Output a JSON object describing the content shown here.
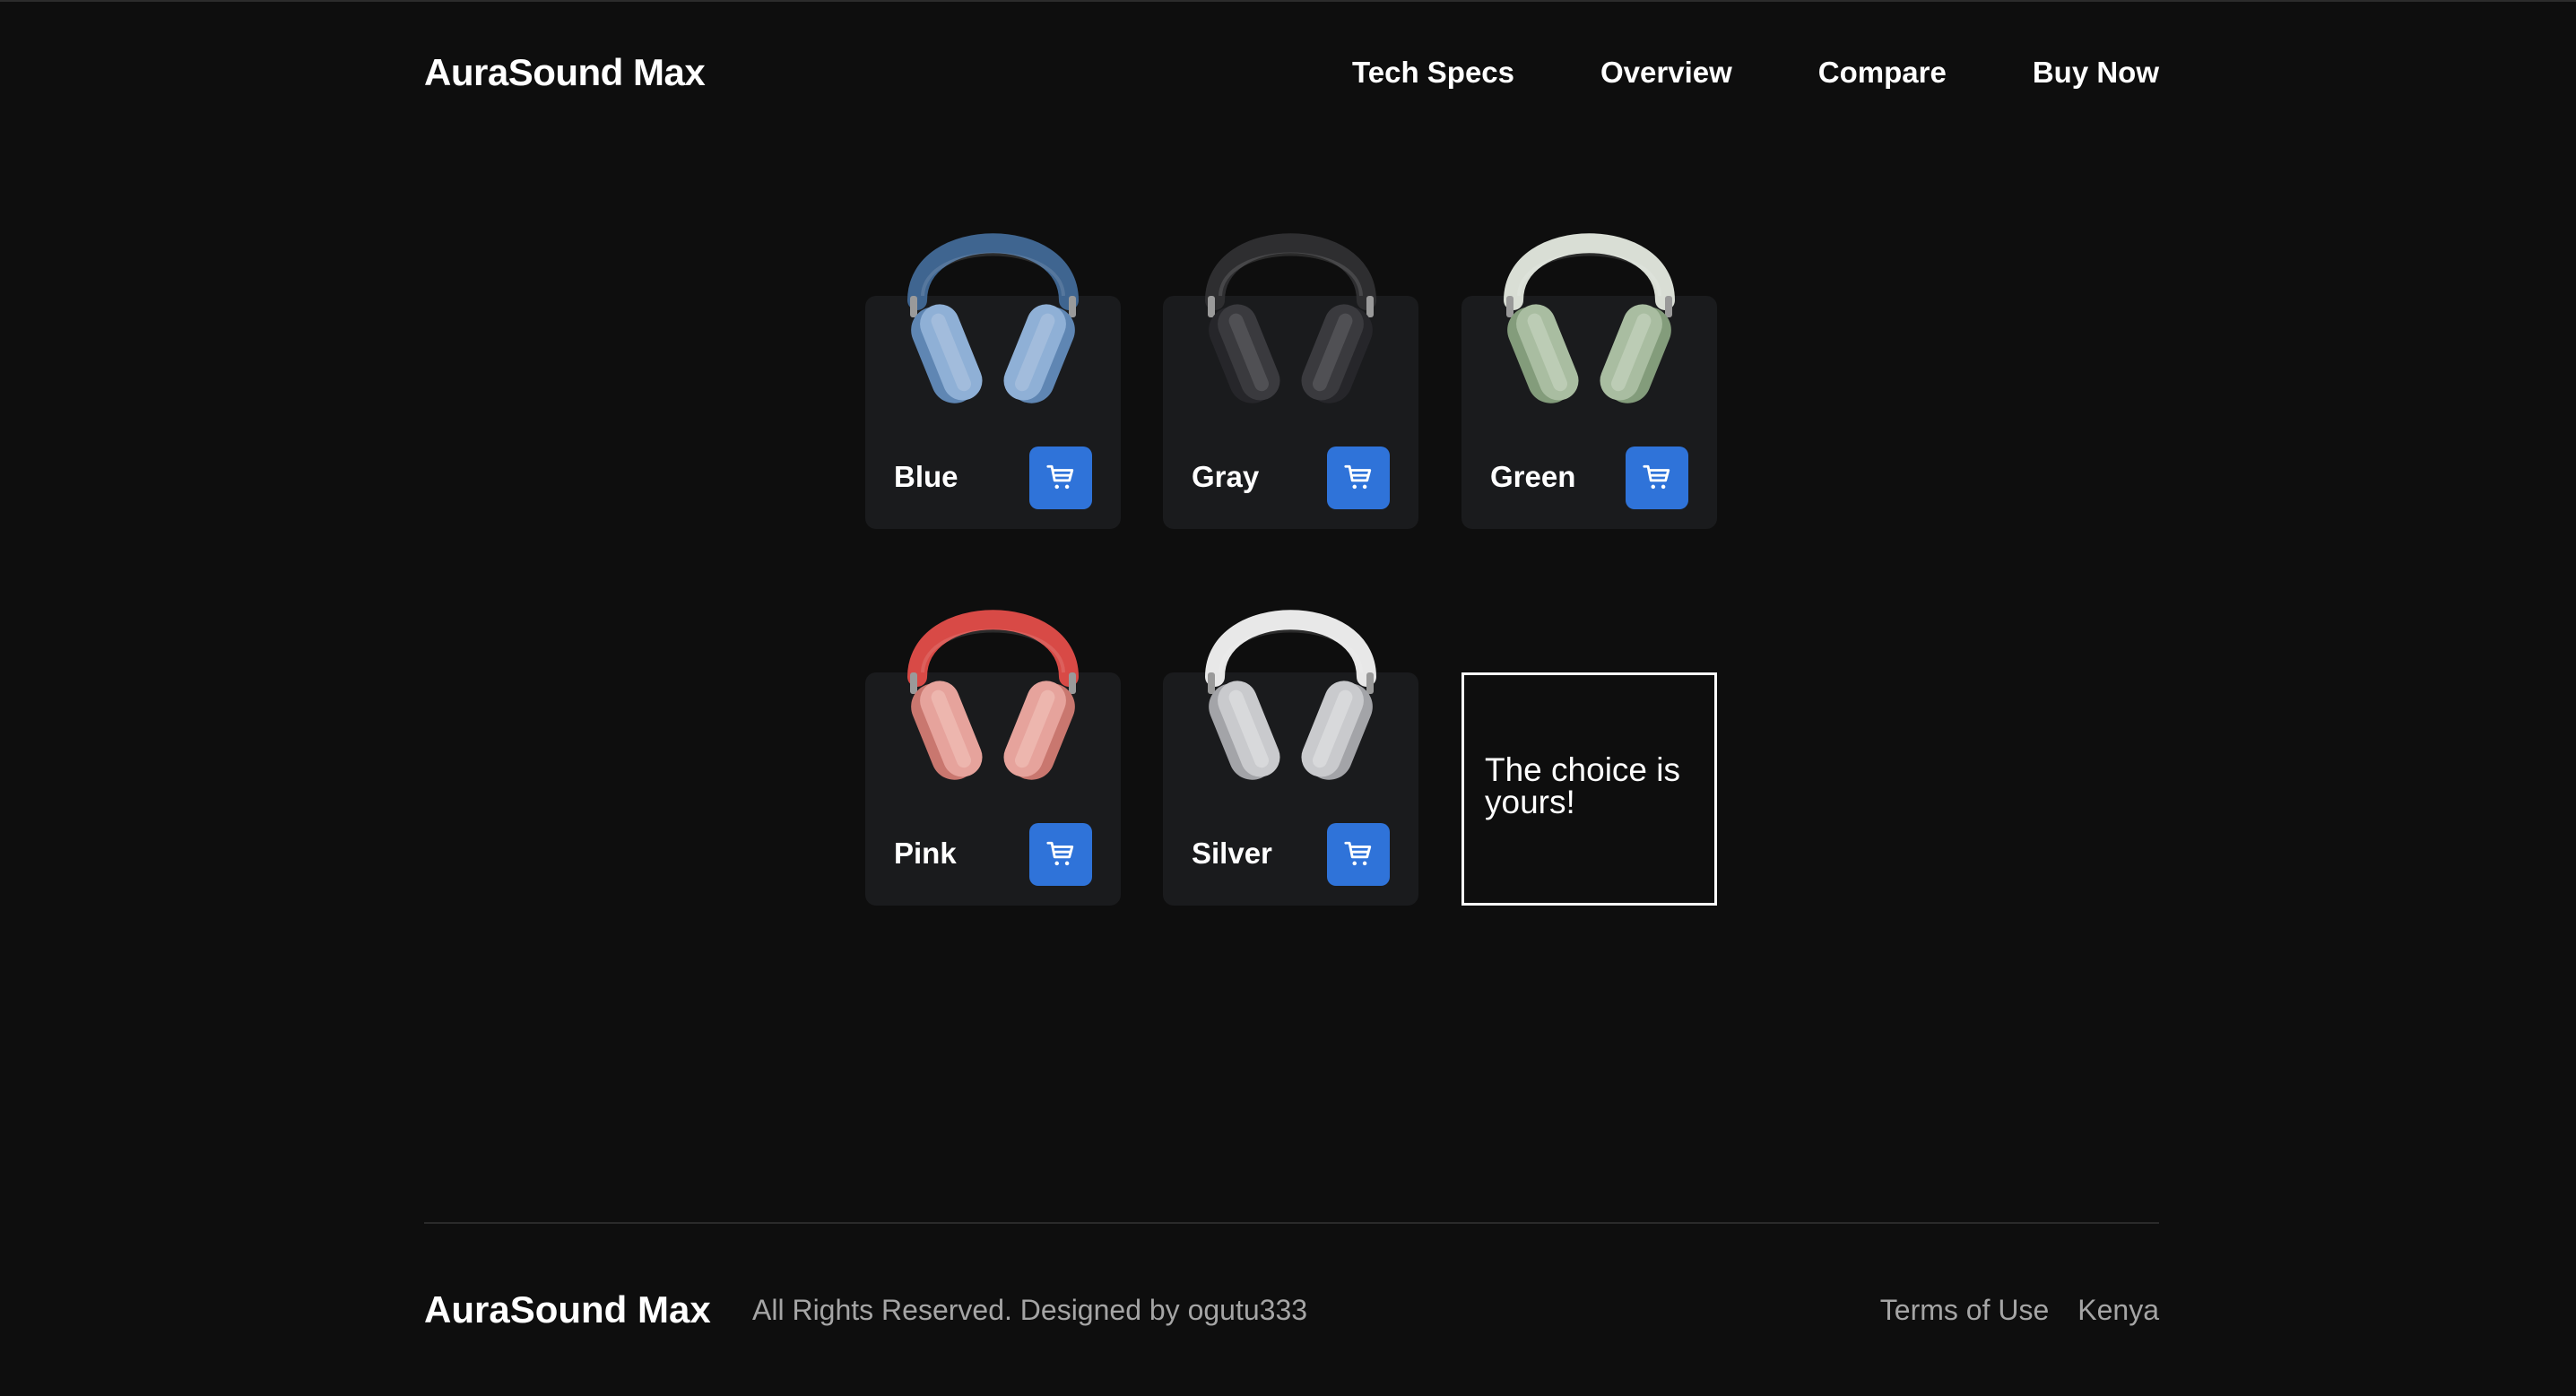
{
  "header": {
    "brand": "AuraSound Max",
    "nav": [
      "Tech Specs",
      "Overview",
      "Compare",
      "Buy Now"
    ]
  },
  "products": [
    {
      "name": "Blue",
      "band": "#3f6590",
      "cup": "#8fb0d6",
      "cup_dark": "#5f86b3",
      "cushion": "#a9c2de",
      "icon": "headphones-blue-icon"
    },
    {
      "name": "Gray",
      "band": "#2e2e30",
      "cup": "#3a3a3e",
      "cup_dark": "#26262a",
      "cushion": "#5a5a5e",
      "icon": "headphones-gray-icon"
    },
    {
      "name": "Green",
      "band": "#d9ded5",
      "cup": "#a9bda1",
      "cup_dark": "#839c7b",
      "cushion": "#c4d3be",
      "icon": "headphones-green-icon"
    },
    {
      "name": "Pink",
      "band": "#d84a46",
      "cup": "#e6a39c",
      "cup_dark": "#c9776f",
      "cushion": "#f0bdb6",
      "icon": "headphones-pink-icon"
    },
    {
      "name": "Silver",
      "band": "#e8e8e8",
      "cup": "#c9cacd",
      "cup_dark": "#a3a4a8",
      "cushion": "#dedfe1",
      "icon": "headphones-silver-icon"
    }
  ],
  "cart_icon": "shopping-cart-icon",
  "accent": "#2f73d9",
  "choice_text": "The choice is yours!",
  "footer": {
    "brand": "AuraSound Max",
    "rights": "All Rights Reserved. Designed by ogutu333",
    "links": [
      "Terms of Use",
      "Kenya"
    ]
  }
}
